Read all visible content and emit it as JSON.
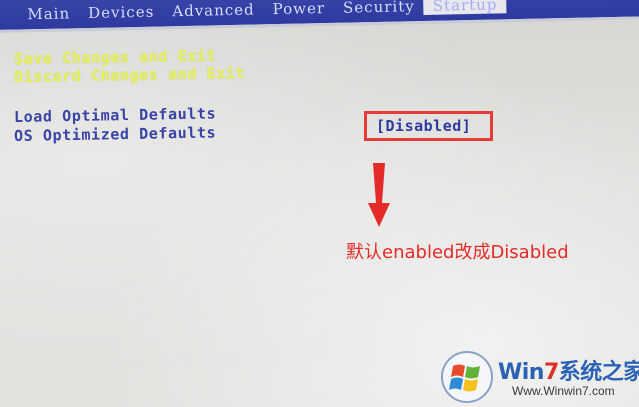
{
  "menu_tabs": [
    {
      "label": "Main"
    },
    {
      "label": "Devices"
    },
    {
      "label": "Advanced"
    },
    {
      "label": "Power"
    },
    {
      "label": "Security"
    },
    {
      "label": "Startup"
    }
  ],
  "menu_tab_active": "Startup",
  "items": {
    "save_exit": "Save Changes and Exit",
    "discard_exit": "Discard Changes and Exit",
    "load_optimal": "Load Optimal Defaults",
    "os_optimized": "OS Optimized Defaults"
  },
  "os_optimized_value": "[Disabled]",
  "annotation": "默认enabled改成Disabled",
  "watermark": {
    "brand_prefix": "Win",
    "brand_digit": "7",
    "brand_suffix": "系统之家",
    "url": "Www.Winwin7.com"
  },
  "colors": {
    "menubar": "#2e3aa0",
    "highlight_text": "#e8f060",
    "normal_text": "#3a44a6",
    "annotation_red": "#e52a2a"
  }
}
